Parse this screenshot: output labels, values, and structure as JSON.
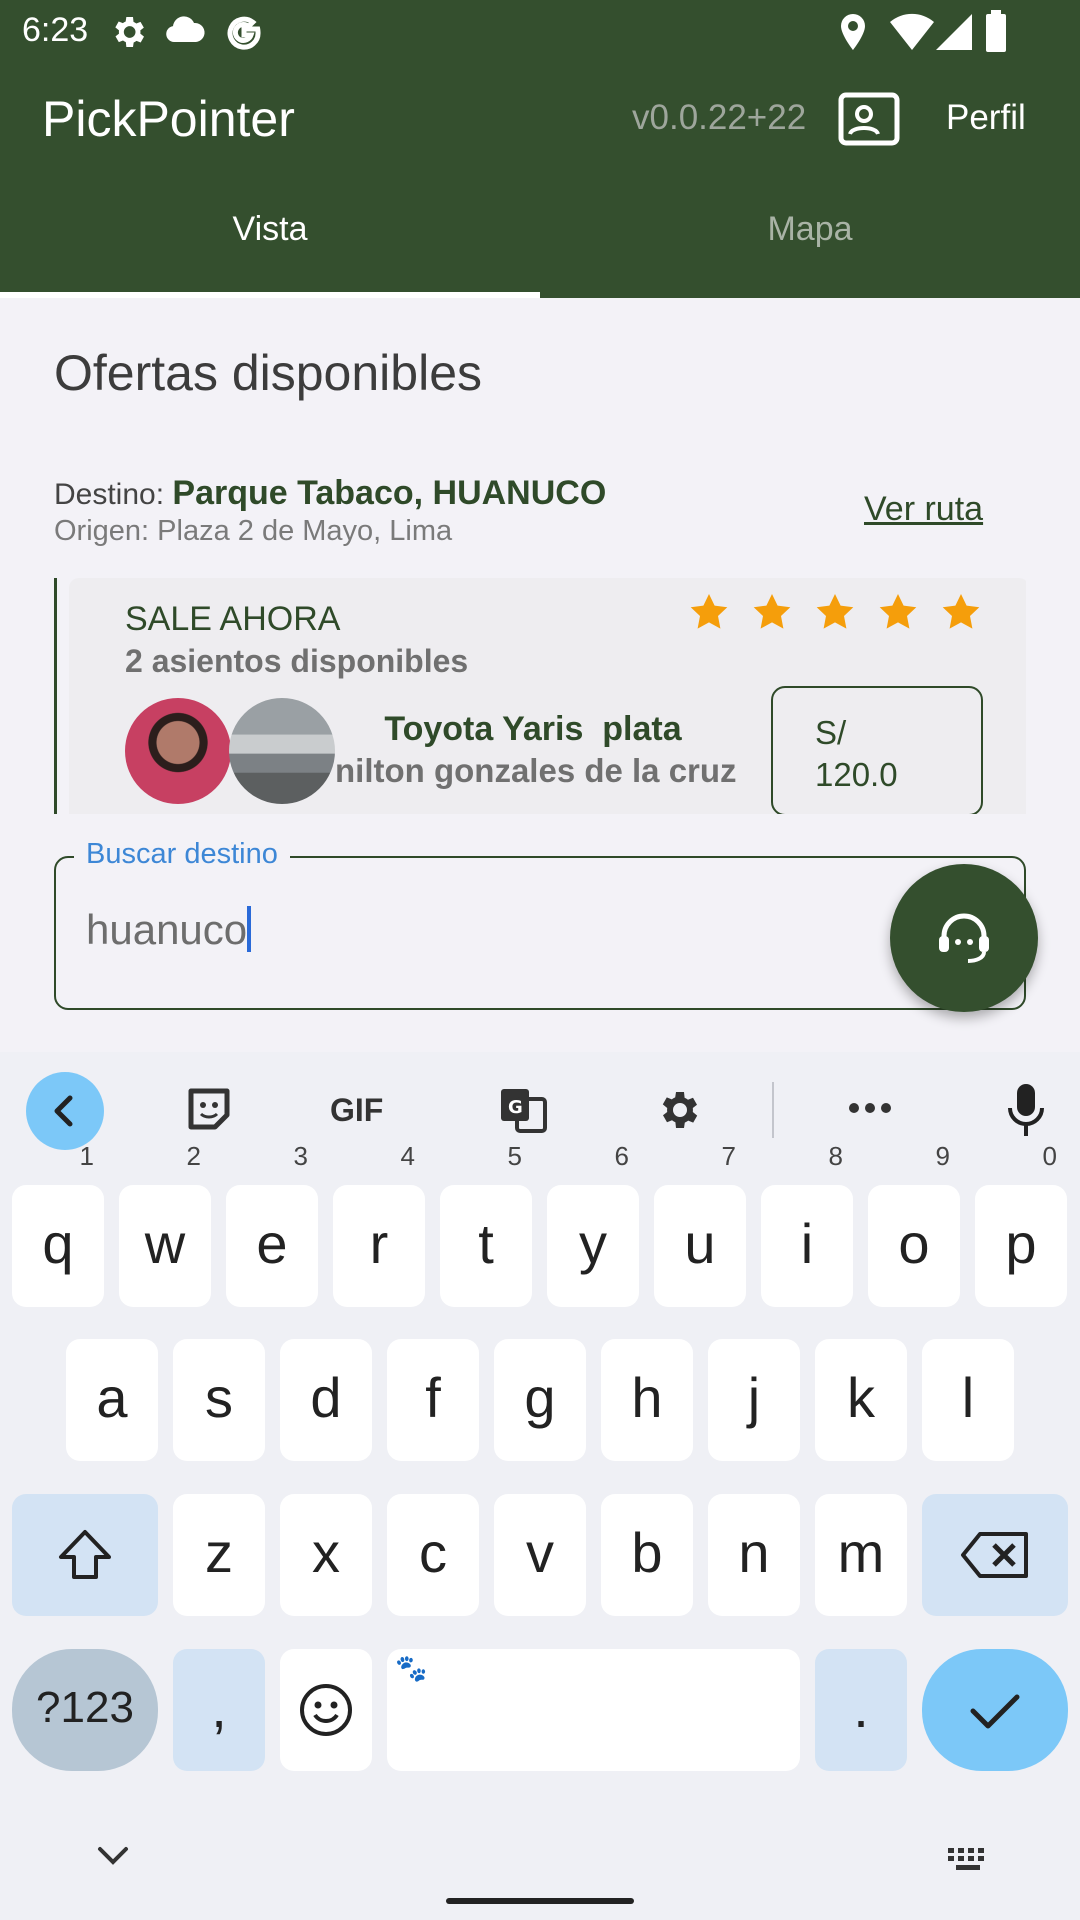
{
  "status_bar": {
    "time": "6:23",
    "left_icons": [
      "gear-icon",
      "cloud-icon",
      "google-icon"
    ],
    "right_icons": [
      "location-icon",
      "wifi-icon",
      "signal-icon",
      "battery-icon"
    ]
  },
  "app_bar": {
    "title": "PickPointer",
    "version": "v0.0.22+22",
    "profile_icon": "id-card-icon",
    "profile_label": "Perfil"
  },
  "tabs": [
    {
      "label": "Vista",
      "active": true
    },
    {
      "label": "Mapa",
      "active": false
    }
  ],
  "main": {
    "heading": "Ofertas disponibles",
    "destination_label": "Destino:",
    "destination_value": "Parque Tabaco, HUANUCO",
    "origin": "Origen: Plaza 2 de Mayo, Lima",
    "route_link": "Ver ruta"
  },
  "offer_card": {
    "status": "SALE AHORA",
    "seats": "2 asientos disponibles",
    "rating": 5,
    "car_model": "Toyota Yaris  plata",
    "driver": "nilton gonzales de la cruz",
    "price_currency": "S/",
    "price_value": "120.0"
  },
  "search": {
    "label": "Buscar destino",
    "value": "huanuco"
  },
  "fab": {
    "icon": "support-agent-icon"
  },
  "keyboard": {
    "toolbar": [
      "back-icon",
      "sticker-icon",
      "GIF",
      "translate-icon",
      "settings-icon",
      "more-icon",
      "mic-icon"
    ],
    "row1": [
      {
        "k": "q",
        "h": "1"
      },
      {
        "k": "w",
        "h": "2"
      },
      {
        "k": "e",
        "h": "3"
      },
      {
        "k": "r",
        "h": "4"
      },
      {
        "k": "t",
        "h": "5"
      },
      {
        "k": "y",
        "h": "6"
      },
      {
        "k": "u",
        "h": "7"
      },
      {
        "k": "i",
        "h": "8"
      },
      {
        "k": "o",
        "h": "9"
      },
      {
        "k": "p",
        "h": "0"
      }
    ],
    "row2": [
      "a",
      "s",
      "d",
      "f",
      "g",
      "h",
      "j",
      "k",
      "l"
    ],
    "row3": [
      "z",
      "x",
      "c",
      "v",
      "b",
      "n",
      "m"
    ],
    "symbols_key": "?123",
    "comma_key": ",",
    "period_key": "."
  },
  "colors": {
    "primary": "#344f2e",
    "accent": "#3d87d6",
    "star": "#f59e0b",
    "keyboard_action": "#7cc8f8"
  }
}
